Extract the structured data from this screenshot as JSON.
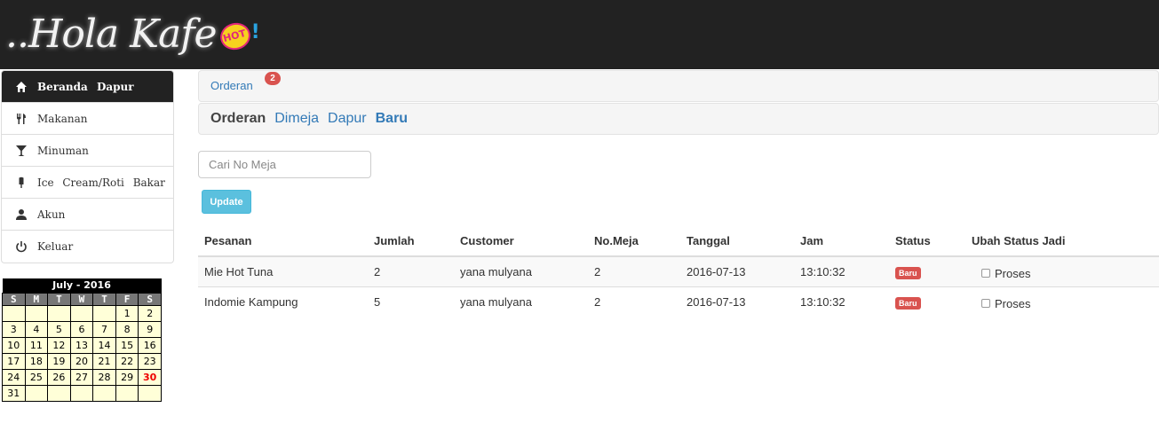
{
  "header": {
    "logo_text": "..Hola Kafe",
    "logo_badge": "HOT",
    "logo_bang": "!"
  },
  "sidebar": {
    "items": [
      {
        "label": "Beranda Dapur",
        "icon": "home-icon",
        "active": true
      },
      {
        "label": "Makanan",
        "icon": "cutlery-icon"
      },
      {
        "label": "Minuman",
        "icon": "glass-icon"
      },
      {
        "label": "Ice Cream/Roti Bakar",
        "icon": "ice-lolly-icon"
      },
      {
        "label": "Akun",
        "icon": "user-icon"
      },
      {
        "label": "Keluar",
        "icon": "power-icon"
      }
    ]
  },
  "calendar": {
    "title": "July - 2016",
    "days_of_week": [
      "S",
      "M",
      "T",
      "W",
      "T",
      "F",
      "S"
    ],
    "weeks": [
      [
        "",
        "",
        "",
        "",
        "",
        "1",
        "2"
      ],
      [
        "3",
        "4",
        "5",
        "6",
        "7",
        "8",
        "9"
      ],
      [
        "10",
        "11",
        "12",
        "13",
        "14",
        "15",
        "16"
      ],
      [
        "17",
        "18",
        "19",
        "20",
        "21",
        "22",
        "23"
      ],
      [
        "24",
        "25",
        "26",
        "27",
        "28",
        "29",
        "30"
      ],
      [
        "31",
        "",
        "",
        "",
        "",
        "",
        ""
      ]
    ],
    "today": "30"
  },
  "breadcrumb": {
    "link": "Orderan",
    "badge": "2"
  },
  "tabs": {
    "current": "Orderan",
    "links": [
      "Dimeja",
      "Dapur"
    ],
    "active": "Baru"
  },
  "search": {
    "placeholder": "Cari No Meja",
    "value": ""
  },
  "update_button": "Update",
  "table": {
    "headers": [
      "Pesanan",
      "Jumlah",
      "Customer",
      "No.Meja",
      "Tanggal",
      "Jam",
      "Status",
      "Ubah Status Jadi"
    ],
    "rows": [
      {
        "pesanan": "Mie Hot Tuna",
        "jumlah": "2",
        "customer": "yana mulyana",
        "meja": "2",
        "tanggal": "2016-07-13",
        "jam": "13:10:32",
        "status": "Baru",
        "ubah": "Proses"
      },
      {
        "pesanan": "Indomie Kampung",
        "jumlah": "5",
        "customer": "yana mulyana",
        "meja": "2",
        "tanggal": "2016-07-13",
        "jam": "13:10:32",
        "status": "Baru",
        "ubah": "Proses"
      }
    ]
  },
  "colors": {
    "header_bg": "#222222",
    "link": "#337ab7",
    "danger": "#d9534f",
    "info": "#5bc0de",
    "calendar_cell": "#ffffd8"
  }
}
